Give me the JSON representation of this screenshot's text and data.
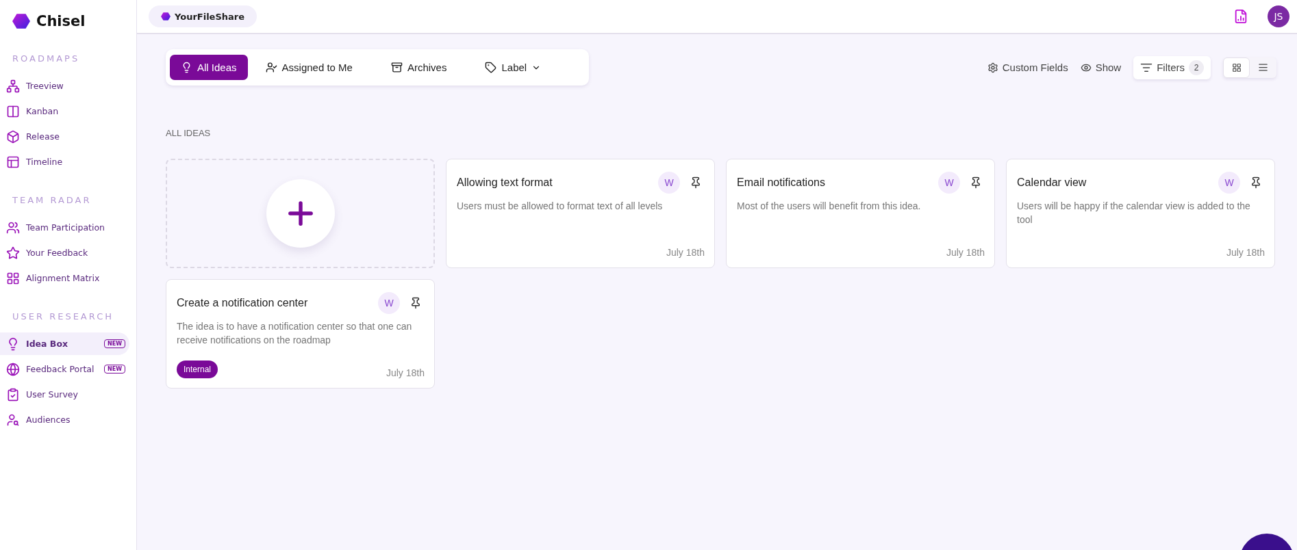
{
  "sidebar": {
    "brand": "Chisel",
    "sections": [
      {
        "title": "ROADMAPS",
        "items": [
          {
            "label": "Treeview",
            "selected": false
          },
          {
            "label": "Kanban",
            "selected": false
          },
          {
            "label": "Release",
            "selected": false
          },
          {
            "label": "Timeline",
            "selected": false
          }
        ]
      },
      {
        "title": "TEAM RADAR",
        "items": [
          {
            "label": "Team Participation",
            "selected": false
          },
          {
            "label": "Your Feedback",
            "selected": false
          },
          {
            "label": "Alignment Matrix",
            "selected": false
          }
        ]
      },
      {
        "title": "USER RESEARCH",
        "items": [
          {
            "label": "Idea Box",
            "selected": true,
            "badge": "NEW"
          },
          {
            "label": "Feedback Portal",
            "selected": false,
            "badge": "NEW"
          },
          {
            "label": "User Survey",
            "selected": false
          },
          {
            "label": "Audiences",
            "selected": false
          }
        ]
      }
    ]
  },
  "topbar": {
    "workspace": "YourFileShare",
    "avatar": "JS"
  },
  "tabs": [
    {
      "label": "All Ideas",
      "selected": true
    },
    {
      "label": "Assigned to Me",
      "selected": false
    },
    {
      "label": "Archives",
      "selected": false
    },
    {
      "label": "Label",
      "selected": false,
      "kind": "dropdown"
    }
  ],
  "toolbar": {
    "custom_fields": "Custom Fields",
    "show": "Show",
    "filters": {
      "label": "Filters",
      "count": "2"
    },
    "view_modes": [
      {
        "selected": true
      },
      {
        "selected": false
      }
    ]
  },
  "section_title": "ALL IDEAS",
  "cards": [
    {
      "title": "Allowing text format",
      "author": "W",
      "description": "Users must be allowed to format text of all levels",
      "date": "July 18th"
    },
    {
      "title": "Email notifications",
      "author": "W",
      "description": "Most of the users will  benefit from this idea.",
      "date": "July 18th"
    },
    {
      "title": "Calendar view",
      "author": "W",
      "description": "Users will be happy if the calendar view is added to the tool",
      "date": "July 18th"
    },
    {
      "title": "Create a notification center",
      "author": "W",
      "description": "The idea is to have a notification center so that one can receive notifications on the roadmap",
      "date": "July 18th",
      "tags": [
        "Internal"
      ]
    }
  ]
}
